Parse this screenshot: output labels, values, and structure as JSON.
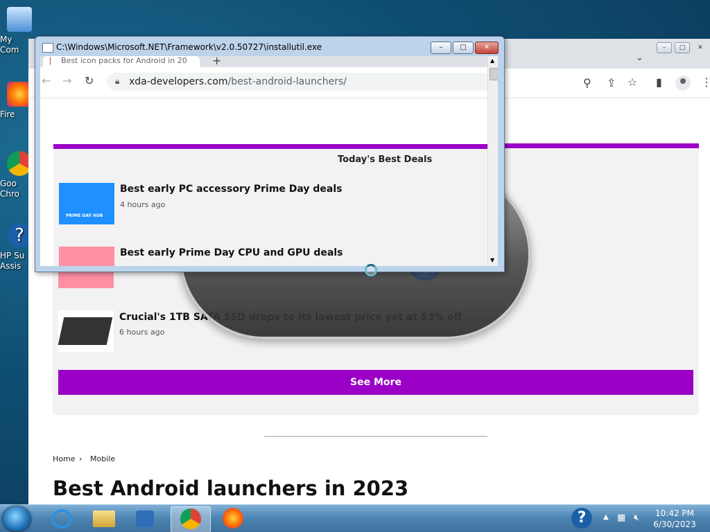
{
  "desktop": {
    "icons": [
      {
        "label": "My Com",
        "name": "desktop-icon-my-computer"
      },
      {
        "label": "Fire",
        "name": "desktop-icon-firefox"
      },
      {
        "label": "Goo Chro",
        "name": "desktop-icon-google-chrome"
      },
      {
        "label": "HP Su Assis",
        "name": "desktop-icon-hp-support-assistant"
      }
    ]
  },
  "browser": {
    "url_host": "xda-developers.com",
    "url_path": "/best-android-launchers/",
    "window_controls": [
      "–",
      "□",
      "✕"
    ]
  },
  "installer": {
    "title": "C:\\Windows\\Microsoft.NET\\Framework\\v2.0.50727\\installutil.exe",
    "tab_title": "Best icon packs for Android in 20",
    "new_tab": "+"
  },
  "deals": {
    "heading": "Today's Best Deals",
    "items": [
      {
        "title": "Best early PC accessory Prime Day deals",
        "time": "4 hours ago",
        "thumb_color": "#1e90ff",
        "thumb_label": "PRIME DAY HUB"
      },
      {
        "title": "Best early Prime Day CPU and GPU deals",
        "time": "",
        "thumb_color": "#ff8fa3"
      },
      {
        "title": "Crucial's 1TB SATA SSD drops to its lowest price yet at 53% off",
        "time": "6 hours ago",
        "thumb_color": "#ffffff"
      }
    ],
    "see_more": "See More"
  },
  "breadcrumb": {
    "home": "Home",
    "sep": "›",
    "section": "Mobile"
  },
  "article": {
    "title": "Best Android launchers in 2023"
  },
  "taskbar": {
    "time": "10:42 PM",
    "date": "6/30/2023"
  },
  "colors": {
    "accent": "#9b00c6"
  }
}
